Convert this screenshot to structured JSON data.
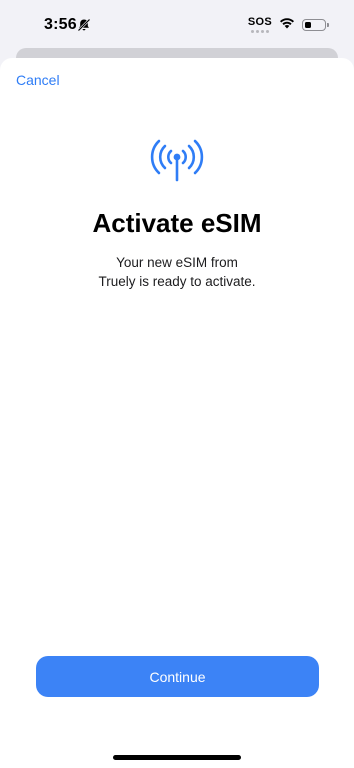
{
  "status_bar": {
    "time": "3:56",
    "sos_label": "SOS",
    "battery_level": 0.35,
    "icons": [
      "bell-slash-icon",
      "wifi-icon",
      "battery-icon"
    ]
  },
  "sheet": {
    "cancel_label": "Cancel",
    "icon": "antenna-icon",
    "title": "Activate eSIM",
    "subtitle_line1": "Your new eSIM from",
    "subtitle_line2": "Truely is ready to activate.",
    "continue_label": "Continue"
  },
  "colors": {
    "accent": "#2f7df6",
    "button": "#3c83f6",
    "background": "#ffffff"
  }
}
